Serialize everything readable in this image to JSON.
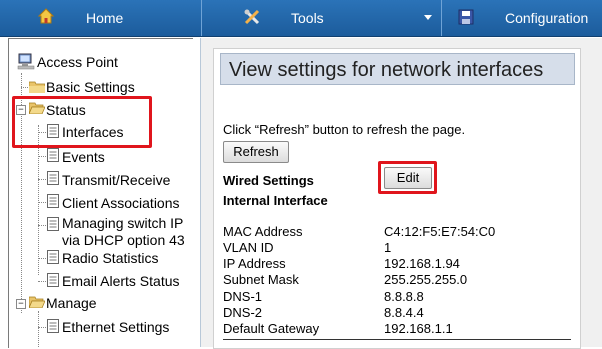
{
  "nav": {
    "home_label": "Home",
    "tools_label": "Tools",
    "config_label": "Configuration",
    "home_icon": "home-icon",
    "tools_icon": "tools-icon",
    "config_icon": "save-disk-icon"
  },
  "sidebar": {
    "root_label": "Access Point",
    "items": [
      {
        "label": "Basic Settings"
      },
      {
        "label": "Status"
      },
      {
        "label": "Interfaces"
      },
      {
        "label": "Events"
      },
      {
        "label": "Transmit/Receive"
      },
      {
        "label": "Client Associations"
      },
      {
        "label": "Managing switch IP"
      },
      {
        "label": "via DHCP option 43"
      },
      {
        "label": "Radio Statistics"
      },
      {
        "label": "Email Alerts Status"
      },
      {
        "label": "Manage"
      },
      {
        "label": "Ethernet Settings"
      }
    ]
  },
  "main": {
    "title": "View settings for network interfaces",
    "instruction": "Click “Refresh” button to refresh the page.",
    "refresh_label": "Refresh",
    "wired_heading": "Wired Settings",
    "edit_label": "Edit",
    "internal_heading": "Internal Interface",
    "rows": [
      {
        "label": "MAC Address",
        "value": "C4:12:F5:E7:54:C0"
      },
      {
        "label": "VLAN ID",
        "value": "1"
      },
      {
        "label": "IP Address",
        "value": "192.168.1.94"
      },
      {
        "label": "Subnet Mask",
        "value": "255.255.255.0"
      },
      {
        "label": "DNS-1",
        "value": "8.8.8.8"
      },
      {
        "label": "DNS-2",
        "value": "8.8.4.4"
      },
      {
        "label": "Default Gateway",
        "value": "192.168.1.1"
      }
    ]
  },
  "colors": {
    "nav_bar": "#1c5c9c",
    "highlight": "#e0151c",
    "title_bar": "#d6deea"
  }
}
